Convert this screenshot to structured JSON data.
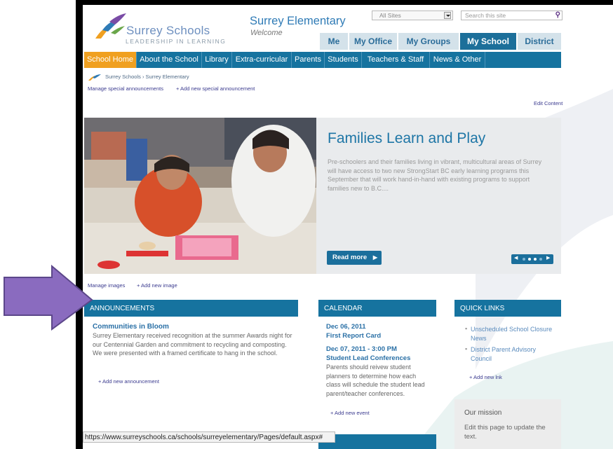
{
  "header": {
    "logo_title": "Surrey Schools",
    "logo_tagline": "LEADERSHIP IN LEARNING",
    "site_title": "Surrey Elementary",
    "site_subtitle": "Welcome",
    "search_scope": "All Sites",
    "search_placeholder": "Search this site"
  },
  "top_tabs": [
    {
      "label": "Me"
    },
    {
      "label": "My Office"
    },
    {
      "label": "My Groups"
    },
    {
      "label": "My School",
      "active": true
    },
    {
      "label": "District"
    }
  ],
  "nav": [
    {
      "label": "School Home",
      "active": true
    },
    {
      "label": "About the School"
    },
    {
      "label": "Library"
    },
    {
      "label": "Extra-curricular"
    },
    {
      "label": "Parents"
    },
    {
      "label": "Students"
    },
    {
      "label": "Teachers & Staff"
    },
    {
      "label": "News & Other"
    }
  ],
  "breadcrumb": {
    "root": "Surrey Schools",
    "separator": "›",
    "current": "Surrey Elementary"
  },
  "admin": {
    "manage_announcements": "Manage special announcements",
    "add_special_announcement": "+ Add new special announcement",
    "edit_content": "Edit Content",
    "manage_images": "Manage images",
    "add_image": "+ Add new image"
  },
  "hero": {
    "title": "Families Learn and Play",
    "description": "Pre-schoolers and their families living in vibrant, multicultural areas of Surrey will have access to two new StrongStart BC early learning programs this September that will work hand-in-hand with existing programs to support families new to B.C....",
    "read_more": "Read more",
    "slides_total": 4,
    "slide_active": 2
  },
  "announcements": {
    "heading": "ANNOUNCEMENTS",
    "item_title": "Communities in Bloom",
    "item_body": "Surrey Elementary received recognition at the summer Awards night for our Centennial Garden and commitment to recycling and composting. We were presented with a framed certificate to hang in the school.",
    "add_link": "+ Add new announcement"
  },
  "calendar": {
    "heading": "CALENDAR",
    "events": [
      {
        "date": "Dec 06, 2011",
        "title": "First Report Card",
        "body": ""
      },
      {
        "date": "Dec 07, 2011 - 3:00 PM",
        "title": "Student Lead Conferences",
        "body": "Parents should reivew student planners to determine how each class will schedule the student lead parent/teacher conferences."
      }
    ],
    "add_link": "+ Add new event"
  },
  "quick_links": {
    "heading": "QUICK LINKS",
    "items": [
      "Unscheduled School Closure News",
      "District Parent Advisory Council"
    ],
    "add_link": "+ Add new lnk"
  },
  "mission": {
    "title": "Our mission",
    "body": "Edit this page to update the text."
  },
  "status_bar": {
    "url": "https://www.surreyschools.ca/schools/surreyelementary/Pages/default.aspx#"
  },
  "colors": {
    "nav_blue": "#16739f",
    "nav_active": "#f0a020",
    "link_blue": "#2a70a6",
    "arrow_purple": "#8a6bbf"
  }
}
